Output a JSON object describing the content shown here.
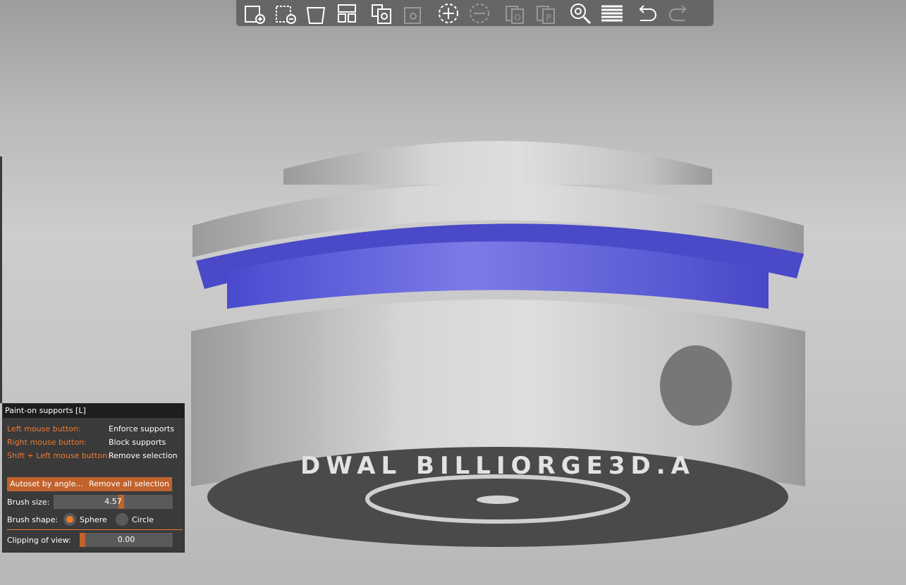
{
  "toolbar": {
    "items": [
      {
        "name": "add",
        "icon": "add-object-icon",
        "enabled": true
      },
      {
        "name": "delete",
        "icon": "delete-object-icon",
        "enabled": true
      },
      {
        "name": "delete-all",
        "icon": "delete-all-icon",
        "enabled": true
      },
      {
        "name": "arrange",
        "icon": "arrange-icon",
        "enabled": true
      },
      {
        "name": "copy",
        "icon": "copy-icon",
        "enabled": true
      },
      {
        "name": "paste",
        "icon": "paste-icon",
        "enabled": false
      },
      {
        "name": "add-instance",
        "icon": "add-instance-icon",
        "enabled": true
      },
      {
        "name": "remove-instance",
        "icon": "remove-instance-icon",
        "enabled": false
      },
      {
        "name": "split-objects",
        "icon": "split-objects-icon",
        "enabled": false
      },
      {
        "name": "split-parts",
        "icon": "split-parts-icon",
        "enabled": false
      },
      {
        "name": "search",
        "icon": "search-icon",
        "enabled": true
      },
      {
        "name": "layers-editing",
        "icon": "layers-icon",
        "enabled": true
      },
      {
        "name": "undo",
        "icon": "undo-icon",
        "enabled": true
      },
      {
        "name": "redo",
        "icon": "redo-icon",
        "enabled": false
      }
    ]
  },
  "panel": {
    "title": "Paint-on supports [L]",
    "hints": [
      {
        "key": "Left mouse button:",
        "action": "Enforce supports"
      },
      {
        "key": "Right mouse button:",
        "action": "Block supports"
      },
      {
        "key": "Shift + Left mouse button:",
        "action": "Remove selection"
      }
    ],
    "autoset_label": "Autoset by angle...",
    "remove_all_label": "Remove all selection",
    "brush_size_label": "Brush size:",
    "brush_size_value": "4.57",
    "brush_size_fraction": 0.57,
    "brush_shape_label": "Brush shape:",
    "shape_options": [
      "Sphere",
      "Circle"
    ],
    "shape_selected": "Sphere",
    "clipping_label": "Clipping of view:",
    "clipping_value": "0.00",
    "clipping_fraction": 0.0
  },
  "model": {
    "embossed_text": "DWAL BILLIORGE3D.A"
  },
  "colors": {
    "accent": "#ee7b30",
    "button": "#c1632d",
    "paint_enforce": "#7b7be8",
    "panel_bg": "#3a3a3a",
    "toolbar_bg": "#666666"
  }
}
